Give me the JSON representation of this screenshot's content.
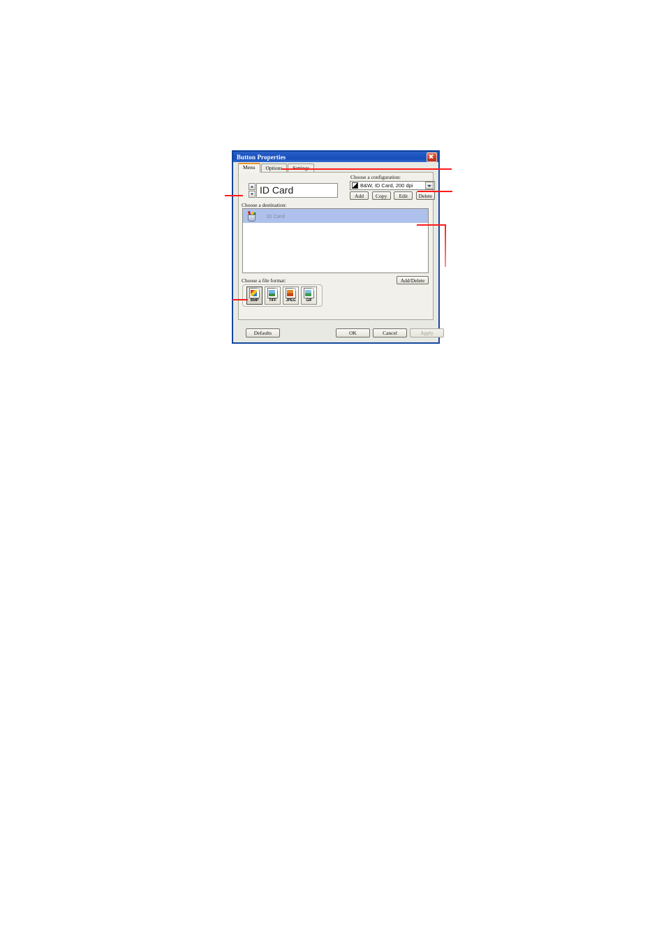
{
  "dialog": {
    "title": "Button Properties",
    "close_label": "Close",
    "tabs": [
      {
        "label": "Menu",
        "active": true
      },
      {
        "label": "Options",
        "active": false
      },
      {
        "label": "Settings",
        "active": false
      }
    ],
    "name_field": {
      "value": "ID Card",
      "spinner_up": "Increase",
      "spinner_down": "Decrease"
    },
    "configuration": {
      "label": "Choose a configuration:",
      "selected": "B&W, ID Card, 200 dpi",
      "buttons": [
        "Add",
        "Copy",
        "Edit",
        "Delete"
      ]
    },
    "destination": {
      "label": "Choose a destination:",
      "items": [
        {
          "label": "ID Card",
          "selected": true
        }
      ],
      "add_delete_label": "Add/Delete"
    },
    "file_format": {
      "label": "Choose a file format:",
      "options": [
        {
          "label": "BMP",
          "selected": true
        },
        {
          "label": "TIFF",
          "selected": false
        },
        {
          "label": "JPEG",
          "selected": false
        },
        {
          "label": "GIF",
          "selected": false
        }
      ]
    },
    "footer": {
      "defaults": "Defaults",
      "ok": "OK",
      "cancel": "Cancel",
      "apply": "Apply"
    },
    "accent_color": "#e8962a",
    "titlebar_color": "#1f55c0",
    "selection_color": "#aec1ec",
    "annotation_color": "#ff1a1a"
  }
}
